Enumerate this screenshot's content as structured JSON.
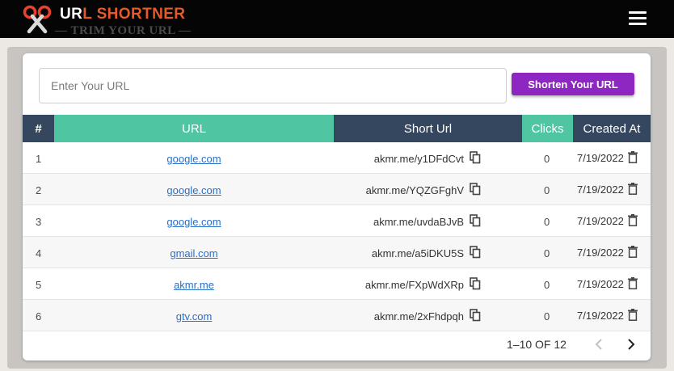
{
  "header": {
    "brand_part1": "UR",
    "brand_part2": "L SHORTNER",
    "tagline": "— TRIM YOUR URL —"
  },
  "form": {
    "placeholder": "Enter Your URL",
    "value": "",
    "button_label": "Shorten Your URL"
  },
  "table": {
    "columns": [
      "#",
      "URL",
      "Short Url",
      "Clicks",
      "Created At"
    ],
    "rows": [
      {
        "num": "1",
        "url": "google.com",
        "short": "akmr.me/y1DFdCvt",
        "clicks": "0",
        "created": "7/19/2022"
      },
      {
        "num": "2",
        "url": "google.com",
        "short": "akmr.me/YQZGFghV",
        "clicks": "0",
        "created": "7/19/2022"
      },
      {
        "num": "3",
        "url": "google.com",
        "short": "akmr.me/uvdaBJvB",
        "clicks": "0",
        "created": "7/19/2022"
      },
      {
        "num": "4",
        "url": "gmail.com",
        "short": "akmr.me/a5iDKU5S",
        "clicks": "0",
        "created": "7/19/2022"
      },
      {
        "num": "5",
        "url": "akmr.me",
        "short": "akmr.me/FXpWdXRp",
        "clicks": "0",
        "created": "7/19/2022"
      },
      {
        "num": "6",
        "url": "gtv.com",
        "short": "akmr.me/2xFhdpqh",
        "clicks": "0",
        "created": "7/19/2022"
      }
    ]
  },
  "pagination": {
    "text": "1–10 OF 12"
  },
  "colors": {
    "accent_purple": "#8e26c2",
    "header_teal": "#4fc5a2",
    "header_navy": "#34475e",
    "brand_orange": "#e55a2b"
  },
  "icons": [
    "scissors-logo-icon",
    "menu-icon",
    "copy-icon",
    "trash-icon",
    "chevron-left-icon",
    "chevron-right-icon"
  ]
}
